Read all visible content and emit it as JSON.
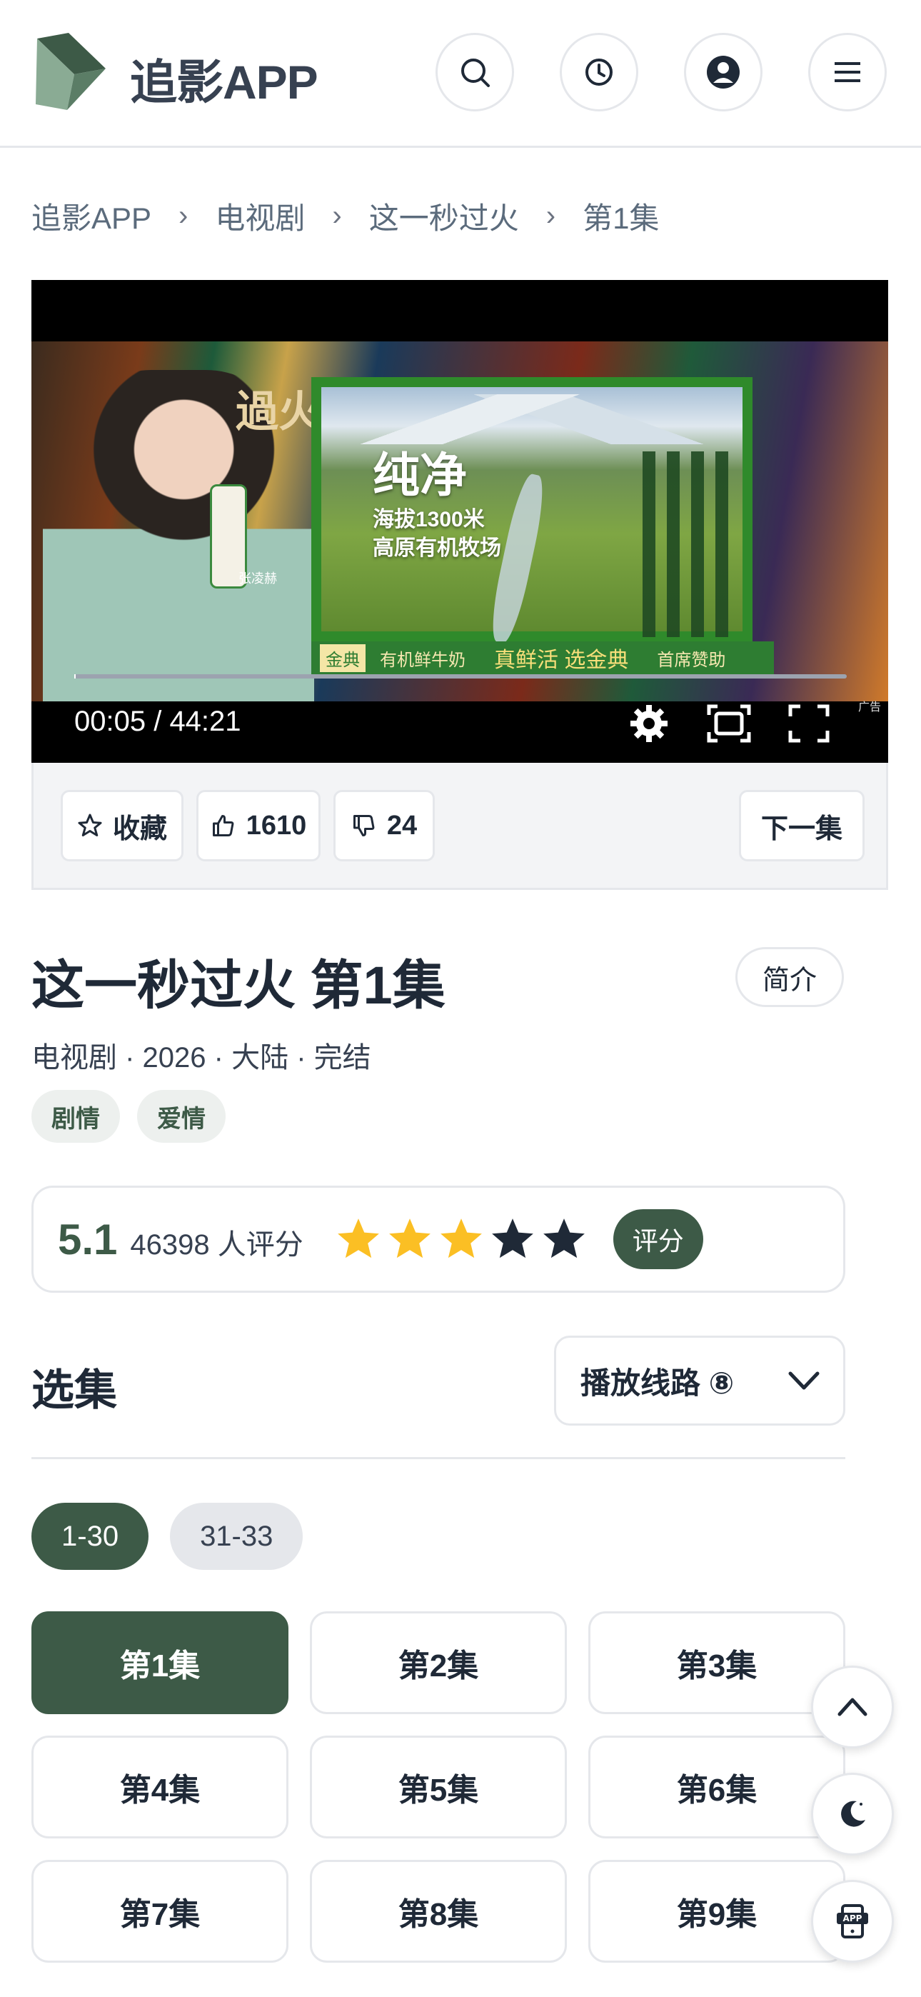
{
  "app": {
    "name": "追影APP",
    "brand_color": "#3d5a47"
  },
  "header": {
    "icons": [
      "search-icon",
      "history-icon",
      "user-icon",
      "menu-icon"
    ]
  },
  "breadcrumb": [
    "追影APP",
    "电视剧",
    "这一秒过火",
    "第1集"
  ],
  "player": {
    "time": "00:05 / 44:21",
    "progress": 0.002,
    "ad": {
      "brand": "過火",
      "headline": "纯净",
      "sub1": "海拔1300米",
      "sub2": "高原有机牧场",
      "endorser": "张凌赫",
      "bar_items": [
        "金典",
        "有机鲜牛奶",
        "真鲜活 选金典",
        "首席赞助"
      ],
      "tag": "广告"
    }
  },
  "actions": {
    "favorite": "收藏",
    "likes": "1610",
    "dislikes": "24",
    "next": "下一集"
  },
  "show": {
    "title": "这一秒过火 第1集",
    "intro_button": "简介",
    "meta": "电视剧 · 2026 · 大陆 · 完结",
    "tags": [
      "剧情",
      "爱情"
    ]
  },
  "rating": {
    "score": "5.1",
    "count": "46398 人评分",
    "stars_filled": 3,
    "stars_total": 5,
    "button": "评分",
    "star_color": "#fbbf24"
  },
  "episodes": {
    "title": "选集",
    "line_select": "播放线路 ⑧",
    "ranges": [
      "1-30",
      "31-33"
    ],
    "active_range": 0,
    "items": [
      "第1集",
      "第2集",
      "第3集",
      "第4集",
      "第5集",
      "第6集",
      "第7集",
      "第8集",
      "第9集"
    ],
    "active_index": 0
  },
  "floating": [
    "arrow-up-icon",
    "moon-icon",
    "app-download-icon"
  ]
}
